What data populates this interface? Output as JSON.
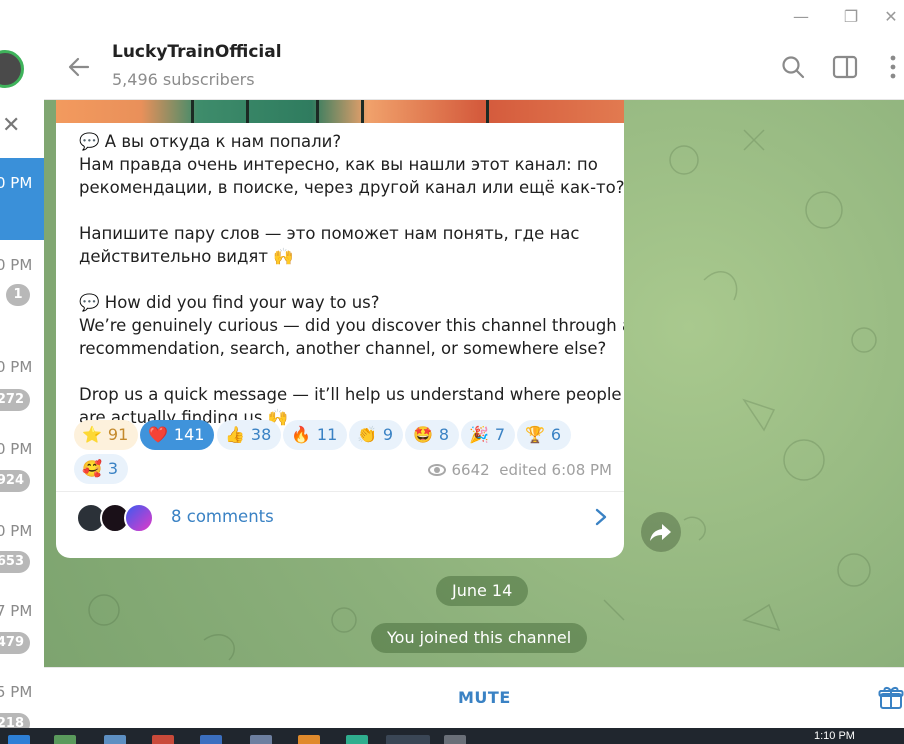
{
  "window": {
    "minimize_glyph": "—",
    "restore_glyph": "❐",
    "close_glyph": "✕"
  },
  "sidebar": {
    "close_glyph": "✕",
    "items": [
      {
        "time": "0 PM",
        "active": true
      },
      {
        "time": "0 PM",
        "badge": "1"
      },
      {
        "time": "0 PM",
        "badge": "272"
      },
      {
        "time": "0 PM",
        "badge": "924"
      },
      {
        "time": "0 PM",
        "badge": "653"
      },
      {
        "time": "7 PM",
        "badge": "479"
      },
      {
        "time": "5 PM",
        "badge": "218"
      }
    ]
  },
  "header": {
    "title": "LuckyTrainOfficial",
    "subscribers": "5,496 subscribers",
    "icons": [
      "back-arrow-icon",
      "search-icon",
      "sidebar-toggle-icon",
      "more-icon"
    ]
  },
  "message": {
    "lines": [
      "💬 А вы откуда к нам попали?",
      "Нам правда очень интересно, как вы нашли этот канал: по",
      "рекомендации, в поиске, через другой канал или ещё как-то?",
      "Напишите пару слов — это поможет нам понять, где нас",
      "действительно видят 🙌",
      "💬 How did you find your way to us?",
      "We’re genuinely curious — did you discover this channel through a",
      "recommendation, search, another channel, or somewhere else?",
      "Drop us a quick message — it’ll help us understand where people",
      "are actually finding us 🙌"
    ],
    "reactions": [
      {
        "emoji": "⭐",
        "count": "91"
      },
      {
        "emoji": "❤️",
        "count": "141"
      },
      {
        "emoji": "👍",
        "count": "38"
      },
      {
        "emoji": "🔥",
        "count": "11"
      },
      {
        "emoji": "👏",
        "count": "9"
      },
      {
        "emoji": "🤩",
        "count": "8"
      },
      {
        "emoji": "🎉",
        "count": "7"
      },
      {
        "emoji": "🏆",
        "count": "6"
      },
      {
        "emoji": "🥰",
        "count": "3"
      }
    ],
    "views": "6642",
    "edited": "edited 6:08 PM",
    "comments_label": "8 comments"
  },
  "service": {
    "date": "June 14",
    "joined": "You joined this channel"
  },
  "bottom": {
    "mute_label": "MUTE"
  },
  "taskbar": {
    "clock": "1:10 PM"
  },
  "colors": {
    "accent": "#3a82c4",
    "selected_reaction": "#3f93db",
    "chat_bg": "#8fb27c",
    "active_chat": "#3a90d9"
  }
}
